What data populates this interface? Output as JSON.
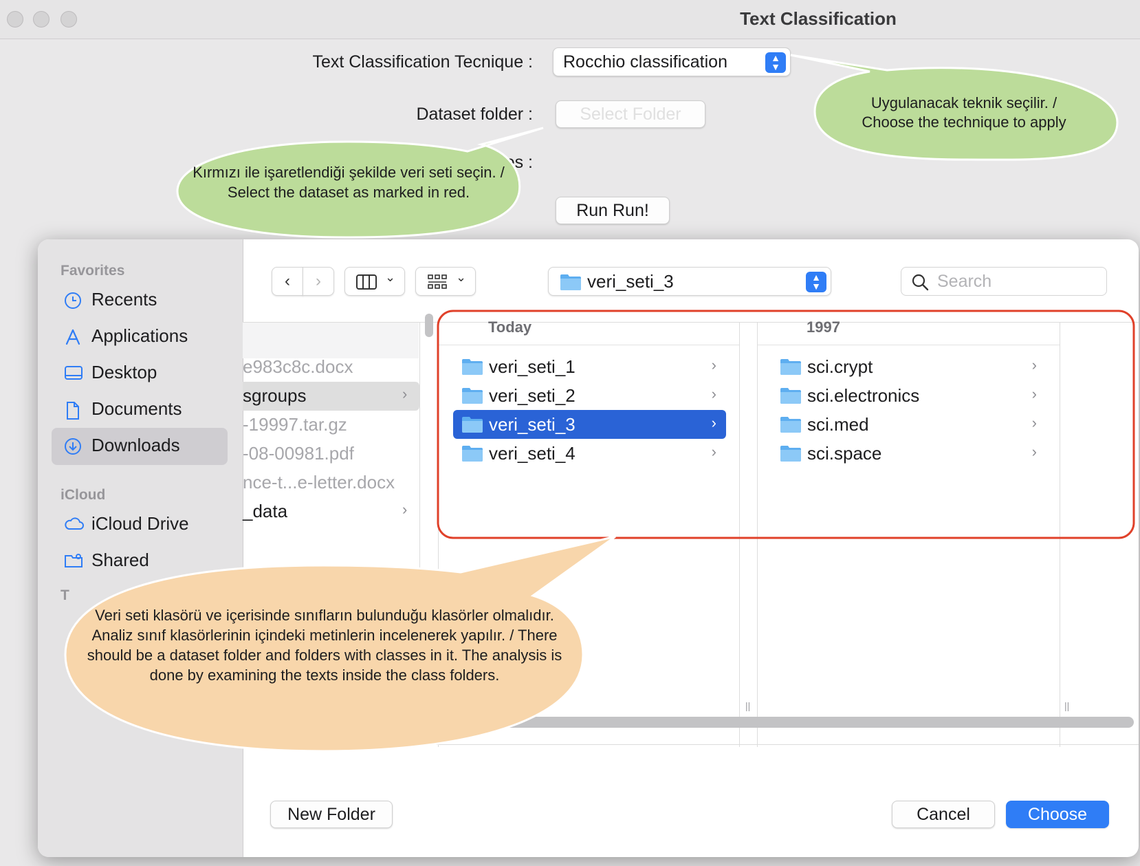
{
  "window": {
    "title": "Text Classification"
  },
  "form": {
    "technique_label": "Text Classification Tecnique :",
    "technique_value": "Rocchio classification",
    "dataset_label": "Dataset folder :",
    "select_folder_label": "Select Folder",
    "hidden_label_fragment": "ues :",
    "run_button_label": "Run Run!"
  },
  "dialog": {
    "sidebar": {
      "favorites_header": "Favorites",
      "favorites": [
        {
          "label": "Recents",
          "icon": "clock-icon"
        },
        {
          "label": "Applications",
          "icon": "applications-icon"
        },
        {
          "label": "Desktop",
          "icon": "desktop-icon"
        },
        {
          "label": "Documents",
          "icon": "document-icon"
        },
        {
          "label": "Downloads",
          "icon": "download-icon",
          "selected": true
        }
      ],
      "icloud_header": "iCloud",
      "icloud": [
        {
          "label": "iCloud Drive",
          "icon": "cloud-icon"
        },
        {
          "label": "Shared",
          "icon": "shared-folder-icon"
        }
      ],
      "tags_header_fragment": "T"
    },
    "toolbar": {
      "back_icon": "chevron-left-icon",
      "forward_icon": "chevron-right-icon",
      "view_icon": "columns-view-icon",
      "group_icon": "grid-icon",
      "path_value": "veri_seti_3",
      "search_placeholder": "Search"
    },
    "previous_column_items": [
      {
        "label": "e983c8c.docx",
        "dimmed": true
      },
      {
        "label": "sgroups",
        "dimmed": false,
        "has_children": true,
        "highlighted": true
      },
      {
        "label": "-19997.tar.gz",
        "dimmed": true
      },
      {
        "label": "-08-00981.pdf",
        "dimmed": true
      },
      {
        "label": "nce-t...e-letter.docx",
        "dimmed": true
      },
      {
        "label": "_data",
        "dimmed": false,
        "has_children": true
      }
    ],
    "column_today": {
      "header": "Today",
      "items": [
        {
          "label": "veri_seti_1",
          "selected": false
        },
        {
          "label": "veri_seti_2",
          "selected": false
        },
        {
          "label": "veri_seti_3",
          "selected": true
        },
        {
          "label": "veri_seti_4",
          "selected": false
        }
      ]
    },
    "column_1997": {
      "header": "1997",
      "items": [
        {
          "label": "sci.crypt"
        },
        {
          "label": "sci.electronics"
        },
        {
          "label": "sci.med"
        },
        {
          "label": "sci.space"
        }
      ]
    },
    "new_folder_label": "New Folder",
    "cancel_label": "Cancel",
    "choose_label": "Choose"
  },
  "callouts": {
    "technique": "Uygulanacak teknik seçilir. / Choose the technique to apply",
    "dataset": "Kırmızı ile işaretlendiği şekilde veri seti seçin. / Select the dataset as marked in red.",
    "structure": "Veri seti klasörü ve içerisinde sınıfların bulunduğu klasörler olmalıdır. Analiz sınıf klasörlerinin içindeki metinlerin incelenerek yapılır. / There should be a dataset folder and folders with classes in it. The analysis is done by examining the texts inside the class folders."
  },
  "colors": {
    "accent": "#2f7df6",
    "selection": "#2a63d6",
    "callout_green": "#bcdc9a",
    "callout_orange": "#f8d6ab",
    "highlight_red": "#e0412a"
  }
}
